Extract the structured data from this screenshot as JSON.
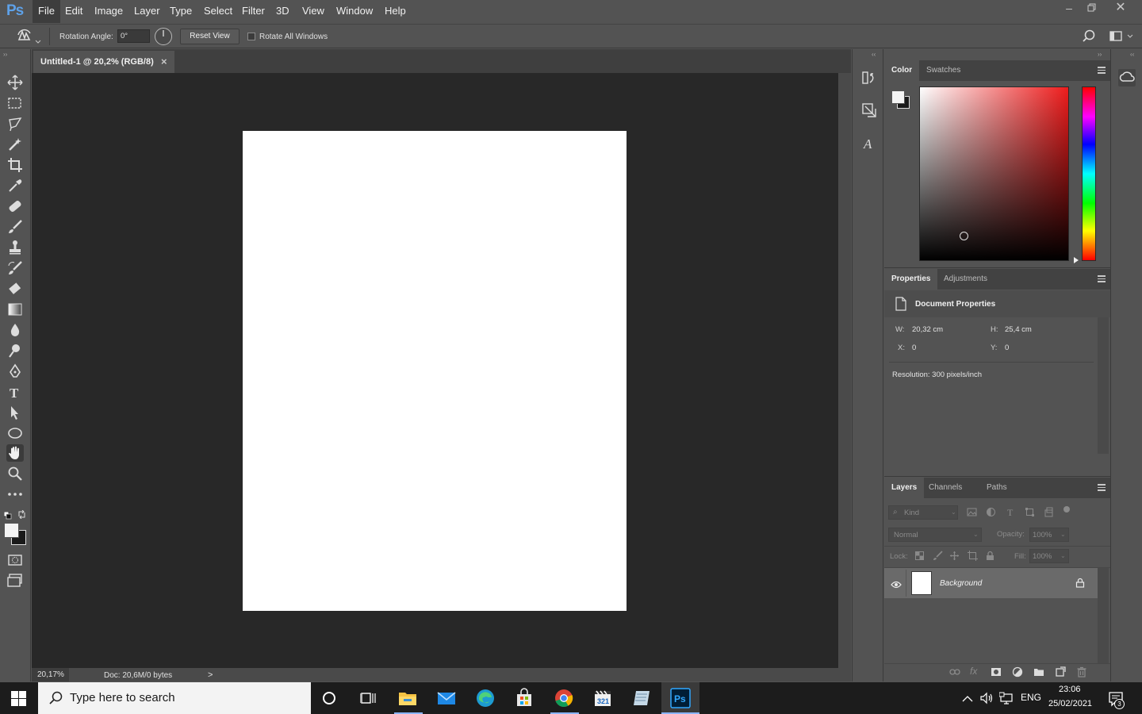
{
  "app": {
    "logo": "Ps"
  },
  "menu": [
    "File",
    "Edit",
    "Image",
    "Layer",
    "Type",
    "Select",
    "Filter",
    "3D",
    "View",
    "Window",
    "Help"
  ],
  "options": {
    "rotation_label": "Rotation Angle:",
    "rotation_value": "0°",
    "reset_view": "Reset View",
    "rotate_all_windows": "Rotate All Windows"
  },
  "document": {
    "tab_title": "Untitled-1 @ 20,2% (RGB/8)",
    "close": "×",
    "zoom": "20,17%",
    "doc_info": "Doc: 20,6M/0 bytes",
    "status_arrow": ">"
  },
  "color_panel": {
    "tabs": [
      "Color",
      "Swatches"
    ],
    "hue_color": "#ee1c1c"
  },
  "properties_panel": {
    "tabs": [
      "Properties",
      "Adjustments"
    ],
    "header": "Document Properties",
    "w_label": "W:",
    "w_value": "20,32 cm",
    "h_label": "H:",
    "h_value": "25,4 cm",
    "x_label": "X:",
    "x_value": "0",
    "y_label": "Y:",
    "y_value": "0",
    "resolution": "Resolution: 300 pixels/inch"
  },
  "layers_panel": {
    "tabs": [
      "Layers",
      "Channels",
      "Paths"
    ],
    "kind_placeholder": "Kind",
    "blend_mode": "Normal",
    "opacity_label": "Opacity:",
    "opacity_value": "100%",
    "lock_label": "Lock:",
    "fill_label": "Fill:",
    "fill_value": "100%",
    "layers": [
      {
        "name": "Background",
        "locked": true,
        "visible": true
      }
    ]
  },
  "taskbar": {
    "search_placeholder": "Type here to search",
    "language": "ENG",
    "time": "23:06",
    "date": "25/02/2021",
    "notifications": "3"
  }
}
